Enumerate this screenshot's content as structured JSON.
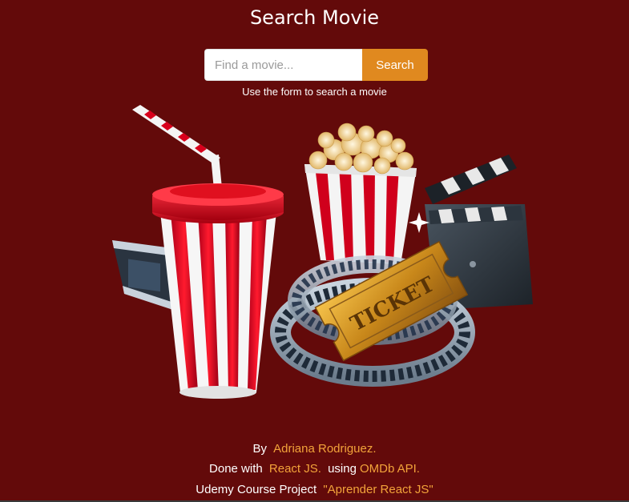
{
  "header": {
    "title": "Search Movie"
  },
  "search": {
    "placeholder": "Find a movie...",
    "value": "",
    "button_label": "Search",
    "help_text": "Use the form to search a movie"
  },
  "hero": {
    "ticket_text": "TICKET"
  },
  "footer": {
    "by_label": "By",
    "author": "Adriana Rodriguez.",
    "done_with_label": "Done with",
    "tech": "React JS.",
    "using_label": "using",
    "api": "OMDb API.",
    "course_label": "Udemy Course Project",
    "course_name": "\"Aprender React JS\""
  },
  "colors": {
    "background": "#630a0a",
    "accent": "#e0891f",
    "link": "#f2a33a"
  }
}
